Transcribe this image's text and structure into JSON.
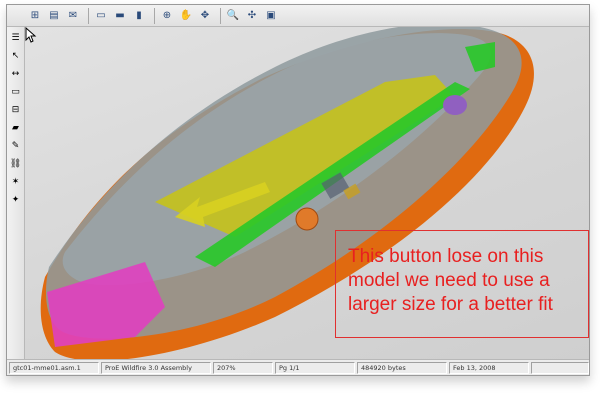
{
  "toolbar": {
    "buttons": [
      {
        "name": "tree-icon",
        "glyph": "⊞"
      },
      {
        "name": "print-icon",
        "glyph": "▤"
      },
      {
        "name": "mail-icon",
        "glyph": "✉"
      },
      {
        "name": "window-cascade-icon",
        "glyph": "▭"
      },
      {
        "name": "window-tile-horizontal-icon",
        "glyph": "▬"
      },
      {
        "name": "window-tile-vertical-icon",
        "glyph": "▮"
      },
      {
        "name": "zoom-all-icon",
        "glyph": "⊕"
      },
      {
        "name": "pan-hand-icon",
        "glyph": "✋"
      },
      {
        "name": "rotate-icon",
        "glyph": "✥"
      },
      {
        "name": "zoom-icon",
        "glyph": "🔍"
      },
      {
        "name": "fit-icon",
        "glyph": "✣"
      },
      {
        "name": "view-icon",
        "glyph": "▣"
      }
    ]
  },
  "sidetool": {
    "buttons": [
      {
        "name": "model-tree-icon",
        "glyph": "☰"
      },
      {
        "name": "select-arrow-icon",
        "glyph": "↖"
      },
      {
        "name": "measure-icon",
        "glyph": "↔"
      },
      {
        "name": "section-icon",
        "glyph": "▭"
      },
      {
        "name": "dimension-icon",
        "glyph": "⊟"
      },
      {
        "name": "folder-icon",
        "glyph": "▰"
      },
      {
        "name": "markup-pen-icon",
        "glyph": "✎"
      },
      {
        "name": "link-icon",
        "glyph": "⛓"
      },
      {
        "name": "explode-icon",
        "glyph": "✶"
      },
      {
        "name": "highlight-icon",
        "glyph": "✦"
      }
    ]
  },
  "annotation": {
    "text": "This button lose on this\nmodel we need to use a\nlarger size for a better fit",
    "border_color": "#e03030",
    "text_color": "#e82020"
  },
  "statusbar": {
    "filename": "gtc01-mme01.asm.1",
    "application": "ProE Wildfire 3.0 Assembly",
    "zoom": "207%",
    "page": "Pg 1/1",
    "size": "484920 bytes",
    "date": "Feb 13, 2008"
  },
  "model_colors": {
    "shell": "#8e9a9e",
    "battery": "#c8c412",
    "pcb": "#28c828",
    "bumper": "#e06a10",
    "pink_part": "#e040c0",
    "purple_part": "#9060c0",
    "button": "#e07a2a"
  }
}
